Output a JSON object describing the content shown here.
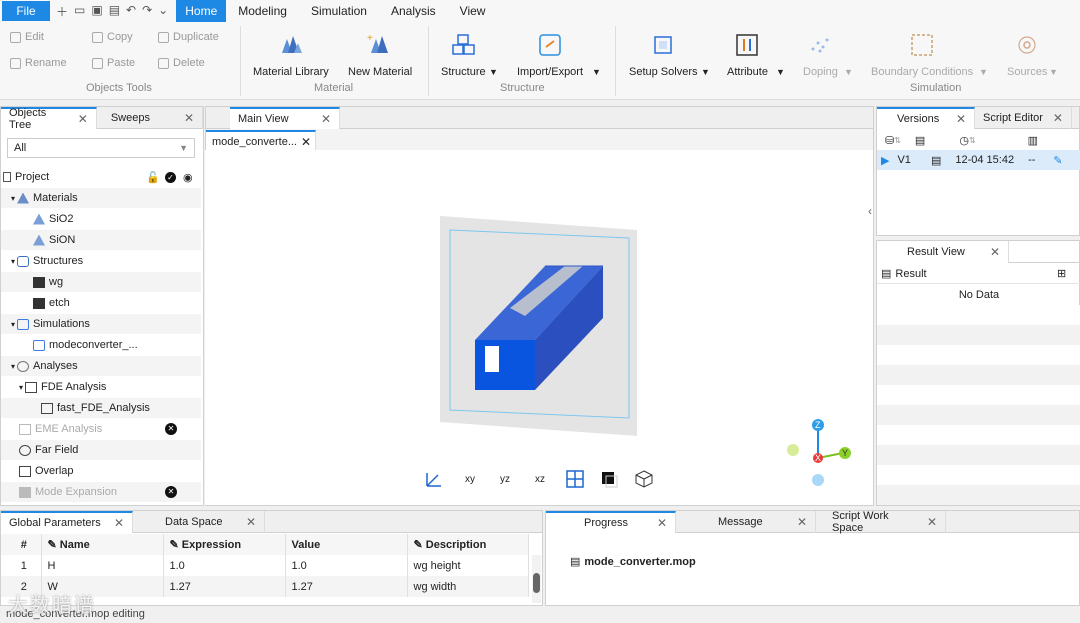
{
  "menubar": {
    "file": "File",
    "tabs": [
      "Home",
      "Modeling",
      "Simulation",
      "Analysis",
      "View"
    ]
  },
  "ribbon": {
    "edit": "Edit",
    "copy": "Copy",
    "duplicate": "Duplicate",
    "rename": "Rename",
    "paste": "Paste",
    "delete": "Delete",
    "objects_tools": "Objects Tools",
    "material_library": "Material Library",
    "new_material": "New Material",
    "material_group": "Material",
    "structure": "Structure",
    "import_export": "Import/Export",
    "structure_group": "Structure",
    "setup_solvers": "Setup Solvers",
    "attribute": "Attribute",
    "doping": "Doping",
    "boundary_conditions": "Boundary Conditions",
    "sources": "Sources",
    "simulation_group": "Simulation"
  },
  "left_tabs": {
    "objects_tree": "Objects Tree",
    "sweeps": "Sweeps"
  },
  "filter": "All",
  "tree": {
    "project": "Project",
    "materials": "Materials",
    "sio2": "SiO2",
    "sion": "SiON",
    "structures": "Structures",
    "wg": "wg",
    "etch": "etch",
    "simulations": "Simulations",
    "modeconverter": "modeconverter_...",
    "analyses": "Analyses",
    "fde": "FDE Analysis",
    "fast_fde": "fast_FDE_Analysis",
    "eme": "EME Analysis",
    "far_field": "Far Field",
    "overlap": "Overlap",
    "mode_expansion": "Mode Expansion"
  },
  "center": {
    "main_view": "Main View",
    "doc_tab": "mode_converte..."
  },
  "axes": {
    "x": "X",
    "y": "Y",
    "z": "Z"
  },
  "viewbar": [
    "xy",
    "yz",
    "xz"
  ],
  "right": {
    "versions": "Versions",
    "script_editor": "Script Editor",
    "version_name": "V1",
    "version_time": "12-04 15:42",
    "version_extra": "--",
    "result_view": "Result View",
    "result": "Result",
    "no_data": "No Data"
  },
  "bottom_left": {
    "tabs": [
      "Global Parameters",
      "Data Space"
    ],
    "headers": [
      "#",
      "Name",
      "Expression",
      "Value",
      "Description"
    ],
    "rows": [
      [
        "1",
        "H",
        "1.0",
        "1.0",
        "wg height"
      ],
      [
        "2",
        "W",
        "1.27",
        "1.27",
        "wg width"
      ]
    ]
  },
  "bottom_right": {
    "tabs": [
      "Progress",
      "Message",
      "Script Work Space"
    ],
    "file": "mode_converter.mop"
  },
  "status": "mode_converter.mop editing",
  "watermark": "大数暗谱"
}
